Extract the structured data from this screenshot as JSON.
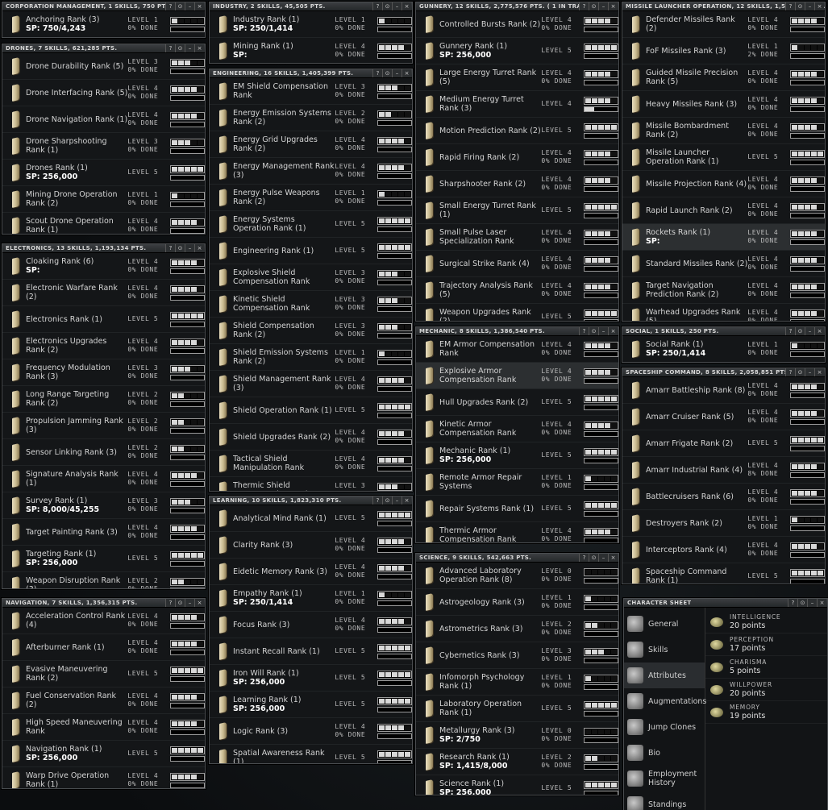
{
  "window_buttons": [
    "?",
    "⊙",
    "–",
    "×"
  ],
  "groups": [
    {
      "key": "corp",
      "title": "CORPORATION MANAGEMENT, 1 SKILLS, 750 PTS.",
      "skills": [
        {
          "name": "Anchoring Rank (3)",
          "sp": "SP: 750/4,243",
          "level": "LEVEL 1",
          "done": "0% DONE",
          "filled": 1,
          "progress": 0
        }
      ]
    },
    {
      "key": "drones",
      "title": "DRONES, 7 SKILLS, 621,285 PTS.",
      "skills": [
        {
          "name": "Drone Durability Rank (5)",
          "level": "LEVEL 3",
          "done": "0% DONE",
          "filled": 3
        },
        {
          "name": "Drone Interfacing Rank (5)",
          "level": "LEVEL 4",
          "done": "0% DONE",
          "filled": 4
        },
        {
          "name": "Drone Navigation Rank (1)",
          "level": "LEVEL 4",
          "done": "0% DONE",
          "filled": 4
        },
        {
          "name": "Drone Sharpshooting Rank (1)",
          "level": "LEVEL 3",
          "done": "0% DONE",
          "filled": 3
        },
        {
          "name": "Drones Rank (1)",
          "sp": "SP: 256,000",
          "level": "LEVEL 5",
          "done": "",
          "filled": 5
        },
        {
          "name": "Mining Drone Operation Rank (2)",
          "level": "LEVEL 1",
          "done": "0% DONE",
          "filled": 1
        },
        {
          "name": "Scout Drone Operation Rank (1)",
          "level": "LEVEL 4",
          "done": "0% DONE",
          "filled": 4
        }
      ]
    },
    {
      "key": "electronics",
      "title": "ELECTRONICS, 13 SKILLS, 1,193,134 PTS.",
      "skills": [
        {
          "name": "Cloaking Rank (6)",
          "sp": "SP:",
          "level": "LEVEL 4",
          "done": "0% DONE",
          "filled": 4
        },
        {
          "name": "Electronic Warfare Rank (2)",
          "level": "LEVEL 4",
          "done": "0% DONE",
          "filled": 4
        },
        {
          "name": "Electronics Rank (1)",
          "level": "LEVEL 5",
          "done": "",
          "filled": 5
        },
        {
          "name": "Electronics Upgrades Rank (2)",
          "level": "LEVEL 4",
          "done": "0% DONE",
          "filled": 4
        },
        {
          "name": "Frequency Modulation Rank (3)",
          "level": "LEVEL 3",
          "done": "0% DONE",
          "filled": 3
        },
        {
          "name": "Long Range Targeting Rank (2)",
          "level": "LEVEL 2",
          "done": "0% DONE",
          "filled": 2
        },
        {
          "name": "Propulsion Jamming Rank (3)",
          "level": "LEVEL 2",
          "done": "0% DONE",
          "filled": 2
        },
        {
          "name": "Sensor Linking Rank (3)",
          "level": "LEVEL 2",
          "done": "0% DONE",
          "filled": 2
        },
        {
          "name": "Signature Analysis Rank (1)",
          "level": "LEVEL 4",
          "done": "0% DONE",
          "filled": 4
        },
        {
          "name": "Survey Rank (1)",
          "sp": "SP: 8,000/45,255",
          "level": "LEVEL 3",
          "done": "0% DONE",
          "filled": 3
        },
        {
          "name": "Target Painting Rank (3)",
          "level": "LEVEL 4",
          "done": "0% DONE",
          "filled": 4
        },
        {
          "name": "Targeting Rank (1)",
          "sp": "SP: 256,000",
          "level": "LEVEL 5",
          "done": "",
          "filled": 5
        },
        {
          "name": "Weapon Disruption Rank (3)",
          "level": "LEVEL 2",
          "done": "0% DONE",
          "filled": 2
        }
      ]
    },
    {
      "key": "navigation",
      "title": "NAVIGATION, 7 SKILLS, 1,356,315 PTS.",
      "skills": [
        {
          "name": "Acceleration Control Rank (4)",
          "level": "LEVEL 4",
          "done": "0% DONE",
          "filled": 4
        },
        {
          "name": "Afterburner Rank (1)",
          "level": "LEVEL 4",
          "done": "0% DONE",
          "filled": 4
        },
        {
          "name": "Evasive Maneuvering Rank (2)",
          "level": "LEVEL 5",
          "done": "",
          "filled": 5
        },
        {
          "name": "Fuel Conservation Rank (2)",
          "level": "LEVEL 4",
          "done": "0% DONE",
          "filled": 4
        },
        {
          "name": "High Speed Maneuvering Rank",
          "level": "LEVEL 4",
          "done": "0% DONE",
          "filled": 4
        },
        {
          "name": "Navigation Rank (1)",
          "sp": "SP: 256,000",
          "level": "LEVEL 5",
          "done": "",
          "filled": 5
        },
        {
          "name": "Warp Drive Operation Rank (1)",
          "level": "LEVEL 4",
          "done": "0% DONE",
          "filled": 4
        }
      ]
    },
    {
      "key": "industry",
      "title": "INDUSTRY, 2 SKILLS, 45,505 PTS.",
      "skills": [
        {
          "name": "Industry Rank (1)",
          "sp": "SP: 250/1,414",
          "level": "LEVEL 1",
          "done": "0% DONE",
          "filled": 1,
          "progress": 0
        },
        {
          "name": "Mining Rank (1)",
          "sp": "SP:",
          "level": "LEVEL 4",
          "done": "0% DONE",
          "filled": 4
        }
      ]
    },
    {
      "key": "engineering",
      "title": "ENGINEERING, 16 SKILLS, 1,405,399 PTS.",
      "skills": [
        {
          "name": "EM Shield Compensation Rank",
          "level": "LEVEL 3",
          "done": "0% DONE",
          "filled": 3
        },
        {
          "name": "Energy Emission Systems Rank (2)",
          "level": "LEVEL 2",
          "done": "0% DONE",
          "filled": 2
        },
        {
          "name": "Energy Grid Upgrades Rank (2)",
          "level": "LEVEL 4",
          "done": "0% DONE",
          "filled": 4
        },
        {
          "name": "Energy Management Rank (3)",
          "level": "LEVEL 4",
          "done": "0% DONE",
          "filled": 4
        },
        {
          "name": "Energy Pulse Weapons Rank (2)",
          "level": "LEVEL 1",
          "done": "0% DONE",
          "filled": 1
        },
        {
          "name": "Energy Systems Operation Rank (1)",
          "level": "LEVEL 5",
          "done": "",
          "filled": 5
        },
        {
          "name": "Engineering Rank (1)",
          "level": "LEVEL 5",
          "done": "",
          "filled": 5
        },
        {
          "name": "Explosive Shield Compensation Rank",
          "level": "LEVEL 3",
          "done": "0% DONE",
          "filled": 3
        },
        {
          "name": "Kinetic Shield Compensation Rank",
          "level": "LEVEL 3",
          "done": "0% DONE",
          "filled": 3
        },
        {
          "name": "Shield Compensation Rank (2)",
          "level": "LEVEL 3",
          "done": "0% DONE",
          "filled": 3
        },
        {
          "name": "Shield Emission Systems Rank (2)",
          "level": "LEVEL 1",
          "done": "0% DONE",
          "filled": 1
        },
        {
          "name": "Shield Management Rank (3)",
          "level": "LEVEL 4",
          "done": "0% DONE",
          "filled": 4
        },
        {
          "name": "Shield Operation Rank (1)",
          "level": "LEVEL 5",
          "done": "",
          "filled": 5
        },
        {
          "name": "Shield Upgrades Rank (2)",
          "level": "LEVEL 4",
          "done": "0% DONE",
          "filled": 4
        },
        {
          "name": "Tactical Shield Manipulation Rank",
          "level": "LEVEL 4",
          "done": "0% DONE",
          "filled": 4
        },
        {
          "name": "Thermic Shield Compensation Rank",
          "level": "LEVEL 3",
          "done": "0% DONE",
          "filled": 3
        }
      ]
    },
    {
      "key": "learning",
      "title": "LEARNING, 10 SKILLS, 1,823,310 PTS.",
      "skills": [
        {
          "name": "Analytical Mind Rank (1)",
          "level": "LEVEL 5",
          "done": "",
          "filled": 5
        },
        {
          "name": "Clarity Rank (3)",
          "level": "LEVEL 4",
          "done": "0% DONE",
          "filled": 4
        },
        {
          "name": "Eidetic Memory Rank (3)",
          "level": "LEVEL 4",
          "done": "0% DONE",
          "filled": 4
        },
        {
          "name": "Empathy Rank (1)",
          "sp": "SP: 250/1,414",
          "level": "LEVEL 1",
          "done": "0% DONE",
          "filled": 1,
          "progress": 0
        },
        {
          "name": "Focus Rank (3)",
          "level": "LEVEL 4",
          "done": "0% DONE",
          "filled": 4
        },
        {
          "name": "Instant Recall Rank (1)",
          "level": "LEVEL 5",
          "done": "",
          "filled": 5
        },
        {
          "name": "Iron Will Rank (1)",
          "sp": "SP: 256,000",
          "level": "LEVEL 5",
          "done": "",
          "filled": 5
        },
        {
          "name": "Learning Rank (1)",
          "sp": "SP: 256,000",
          "level": "LEVEL 5",
          "done": "",
          "filled": 5
        },
        {
          "name": "Logic Rank (3)",
          "level": "LEVEL 4",
          "done": "0% DONE",
          "filled": 4
        },
        {
          "name": "Spatial Awareness Rank (1)",
          "level": "LEVEL 5",
          "done": "",
          "filled": 5
        }
      ]
    },
    {
      "key": "gunnery",
      "title": "GUNNERY, 12 SKILLS, 2,775,576 PTS. ( 1 IN TRAINING )",
      "skills": [
        {
          "name": "Controlled Bursts Rank (2)",
          "level": "LEVEL 4",
          "done": "0% DONE",
          "filled": 4
        },
        {
          "name": "Gunnery Rank (1)",
          "sp": "SP: 256,000",
          "level": "LEVEL 5",
          "done": "",
          "filled": 5
        },
        {
          "name": "Large Energy Turret Rank (5)",
          "level": "LEVEL 4",
          "done": "0% DONE",
          "filled": 4
        },
        {
          "name": "Medium Energy Turret Rank (3)",
          "level": "LEVEL 4",
          "done": "",
          "filled": 4,
          "progress": 30
        },
        {
          "name": "Motion Prediction Rank (2)",
          "level": "LEVEL 5",
          "done": "",
          "filled": 5
        },
        {
          "name": "Rapid Firing Rank (2)",
          "level": "LEVEL 4",
          "done": "0% DONE",
          "filled": 4
        },
        {
          "name": "Sharpshooter Rank (2)",
          "level": "LEVEL 4",
          "done": "0% DONE",
          "filled": 4
        },
        {
          "name": "Small Energy Turret Rank (1)",
          "level": "LEVEL 5",
          "done": "",
          "filled": 5
        },
        {
          "name": "Small Pulse Laser Specialization Rank",
          "level": "LEVEL 4",
          "done": "0% DONE",
          "filled": 4
        },
        {
          "name": "Surgical Strike Rank (4)",
          "level": "LEVEL 4",
          "done": "0% DONE",
          "filled": 4
        },
        {
          "name": "Trajectory Analysis Rank (5)",
          "level": "LEVEL 4",
          "done": "0% DONE",
          "filled": 4
        },
        {
          "name": "Weapon Upgrades Rank (2)",
          "level": "LEVEL 5",
          "done": "",
          "filled": 5
        }
      ]
    },
    {
      "key": "mechanic",
      "title": "MECHANIC, 8 SKILLS, 1,386,540 PTS.",
      "skills": [
        {
          "name": "EM Armor Compensation Rank",
          "level": "LEVEL 4",
          "done": "0% DONE",
          "filled": 4
        },
        {
          "name": "Explosive Armor Compensation Rank",
          "level": "LEVEL 4",
          "done": "0% DONE",
          "filled": 4,
          "hl": true
        },
        {
          "name": "Hull Upgrades Rank (2)",
          "level": "LEVEL 5",
          "done": "",
          "filled": 5
        },
        {
          "name": "Kinetic Armor Compensation Rank",
          "level": "LEVEL 4",
          "done": "0% DONE",
          "filled": 4
        },
        {
          "name": "Mechanic Rank (1)",
          "sp": "SP: 256,000",
          "level": "LEVEL 5",
          "done": "",
          "filled": 5
        },
        {
          "name": "Remote Armor Repair Systems",
          "level": "LEVEL 1",
          "done": "0% DONE",
          "filled": 1
        },
        {
          "name": "Repair Systems Rank (1)",
          "level": "LEVEL 5",
          "done": "",
          "filled": 5
        },
        {
          "name": "Thermic Armor Compensation Rank",
          "level": "LEVEL 4",
          "done": "0% DONE",
          "filled": 4
        }
      ]
    },
    {
      "key": "science",
      "title": "SCIENCE, 9 SKILLS, 542,663 PTS.",
      "skills": [
        {
          "name": "Advanced Laboratory Operation Rank (8)",
          "level": "LEVEL 0",
          "done": "0% DONE",
          "filled": 0
        },
        {
          "name": "Astrogeology Rank (3)",
          "level": "LEVEL 1",
          "done": "0% DONE",
          "filled": 1
        },
        {
          "name": "Astrometrics Rank (3)",
          "level": "LEVEL 2",
          "done": "0% DONE",
          "filled": 2
        },
        {
          "name": "Cybernetics Rank (3)",
          "level": "LEVEL 3",
          "done": "0% DONE",
          "filled": 3
        },
        {
          "name": "Infomorph Psychology Rank (1)",
          "level": "LEVEL 1",
          "done": "0% DONE",
          "filled": 1
        },
        {
          "name": "Laboratory Operation Rank (1)",
          "level": "LEVEL 5",
          "done": "",
          "filled": 5
        },
        {
          "name": "Metallurgy Rank (3)",
          "sp": "SP: 2/750",
          "level": "LEVEL 0",
          "done": "0% DONE",
          "filled": 0,
          "progress": 0
        },
        {
          "name": "Research Rank (1)",
          "sp": "SP: 1,415/8,000",
          "level": "LEVEL 2",
          "done": "0% DONE",
          "filled": 2,
          "progress": 0
        },
        {
          "name": "Science Rank (1)",
          "sp": "SP: 256,000",
          "level": "LEVEL 5",
          "done": "",
          "filled": 5
        }
      ]
    },
    {
      "key": "missile",
      "title": "MISSILE LAUNCHER OPERATION, 12 SKILLS, 1,524,103 PTS.",
      "skills": [
        {
          "name": "Defender Missiles Rank (2)",
          "level": "LEVEL 4",
          "done": "0% DONE",
          "filled": 4
        },
        {
          "name": "FoF Missiles Rank (3)",
          "level": "LEVEL 1",
          "done": "2% DONE",
          "filled": 1
        },
        {
          "name": "Guided Missile Precision Rank (5)",
          "level": "LEVEL 4",
          "done": "0% DONE",
          "filled": 4
        },
        {
          "name": "Heavy Missiles Rank (3)",
          "level": "LEVEL 4",
          "done": "0% DONE",
          "filled": 4
        },
        {
          "name": "Missile Bombardment Rank (2)",
          "level": "LEVEL 4",
          "done": "0% DONE",
          "filled": 4
        },
        {
          "name": "Missile Launcher Operation Rank (1)",
          "level": "LEVEL 5",
          "done": "",
          "filled": 5
        },
        {
          "name": "Missile Projection Rank (4)",
          "level": "LEVEL 4",
          "done": "0% DONE",
          "filled": 4
        },
        {
          "name": "Rapid Launch Rank (2)",
          "level": "LEVEL 4",
          "done": "0% DONE",
          "filled": 4
        },
        {
          "name": "Rockets Rank (1)",
          "sp": "SP:",
          "level": "LEVEL 4",
          "done": "0% DONE",
          "filled": 4,
          "hl": true
        },
        {
          "name": "Standard Missiles Rank (2)",
          "level": "LEVEL 4",
          "done": "0% DONE",
          "filled": 4
        },
        {
          "name": "Target Navigation Prediction Rank (2)",
          "level": "LEVEL 4",
          "done": "0% DONE",
          "filled": 4
        },
        {
          "name": "Warhead Upgrades Rank (5)",
          "level": "LEVEL 4",
          "done": "0% DONE",
          "filled": 4
        }
      ]
    },
    {
      "key": "social",
      "title": "SOCIAL, 1 SKILLS, 250 PTS.",
      "skills": [
        {
          "name": "Social Rank (1)",
          "sp": "SP: 250/1,414",
          "level": "LEVEL 1",
          "done": "0% DONE",
          "filled": 1,
          "progress": 0
        }
      ]
    },
    {
      "key": "spaceship",
      "title": "SPACESHIP COMMAND, 8 SKILLS, 2,058,851 PTS.",
      "skills": [
        {
          "name": "Amarr Battleship Rank (8)",
          "level": "LEVEL 4",
          "done": "0% DONE",
          "filled": 4
        },
        {
          "name": "Amarr Cruiser Rank (5)",
          "level": "LEVEL 4",
          "done": "0% DONE",
          "filled": 4
        },
        {
          "name": "Amarr Frigate Rank (2)",
          "level": "LEVEL 5",
          "done": "",
          "filled": 5
        },
        {
          "name": "Amarr Industrial Rank (4)",
          "level": "LEVEL 4",
          "done": "8% DONE",
          "filled": 4
        },
        {
          "name": "Battlecruisers Rank (6)",
          "level": "LEVEL 4",
          "done": "0% DONE",
          "filled": 4
        },
        {
          "name": "Destroyers Rank (2)",
          "level": "LEVEL 1",
          "done": "0% DONE",
          "filled": 1
        },
        {
          "name": "Interceptors Rank (4)",
          "level": "LEVEL 4",
          "done": "0% DONE",
          "filled": 4
        },
        {
          "name": "Spaceship Command Rank (1)",
          "level": "LEVEL 5",
          "done": "",
          "filled": 5
        }
      ]
    }
  ],
  "character_sheet": {
    "title": "CHARACTER SHEET",
    "nav": [
      {
        "label": "General",
        "icon": "portrait-icon"
      },
      {
        "label": "Skills",
        "icon": "skill-book-icon"
      },
      {
        "label": "Attributes",
        "icon": "attributes-icon",
        "active": true
      },
      {
        "label": "Augmentations",
        "icon": "augmentations-icon"
      },
      {
        "label": "Jump Clones",
        "icon": "jump-clones-icon"
      },
      {
        "label": "Bio",
        "icon": "bio-icon"
      },
      {
        "label": "Employment History",
        "icon": "employment-icon"
      },
      {
        "label": "Standings",
        "icon": "standings-icon"
      }
    ],
    "attributes": [
      {
        "name": "INTELLIGENCE",
        "points": "20 points"
      },
      {
        "name": "PERCEPTION",
        "points": "17 points"
      },
      {
        "name": "CHARISMA",
        "points": "5 points"
      },
      {
        "name": "WILLPOWER",
        "points": "20 points"
      },
      {
        "name": "MEMORY",
        "points": "19 points"
      }
    ]
  }
}
